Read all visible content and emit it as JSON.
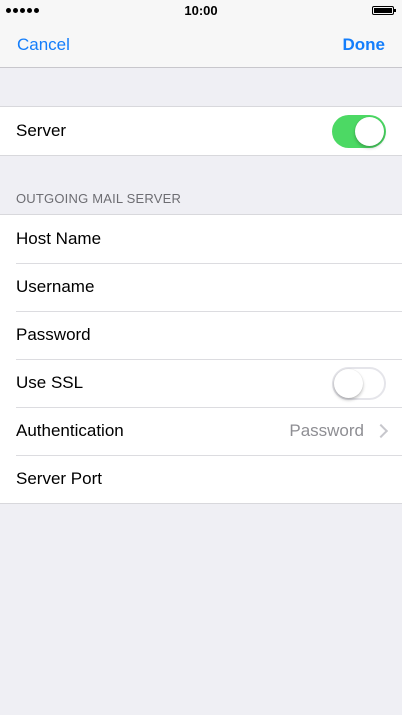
{
  "status_bar": {
    "time": "10:00",
    "signal_icon": "signal-dots-icon",
    "battery_icon": "battery-full-icon"
  },
  "nav": {
    "cancel_label": "Cancel",
    "done_label": "Done"
  },
  "server_group": {
    "server_label": "Server",
    "server_enabled": true
  },
  "outgoing": {
    "header": "OUTGOING MAIL SERVER",
    "host_name_label": "Host Name",
    "username_label": "Username",
    "password_label": "Password",
    "use_ssl_label": "Use SSL",
    "use_ssl_enabled": false,
    "authentication_label": "Authentication",
    "authentication_value": "Password",
    "server_port_label": "Server Port"
  },
  "colors": {
    "accent": "#147efb",
    "switch_on": "#4cd964",
    "background": "#efeff4"
  }
}
